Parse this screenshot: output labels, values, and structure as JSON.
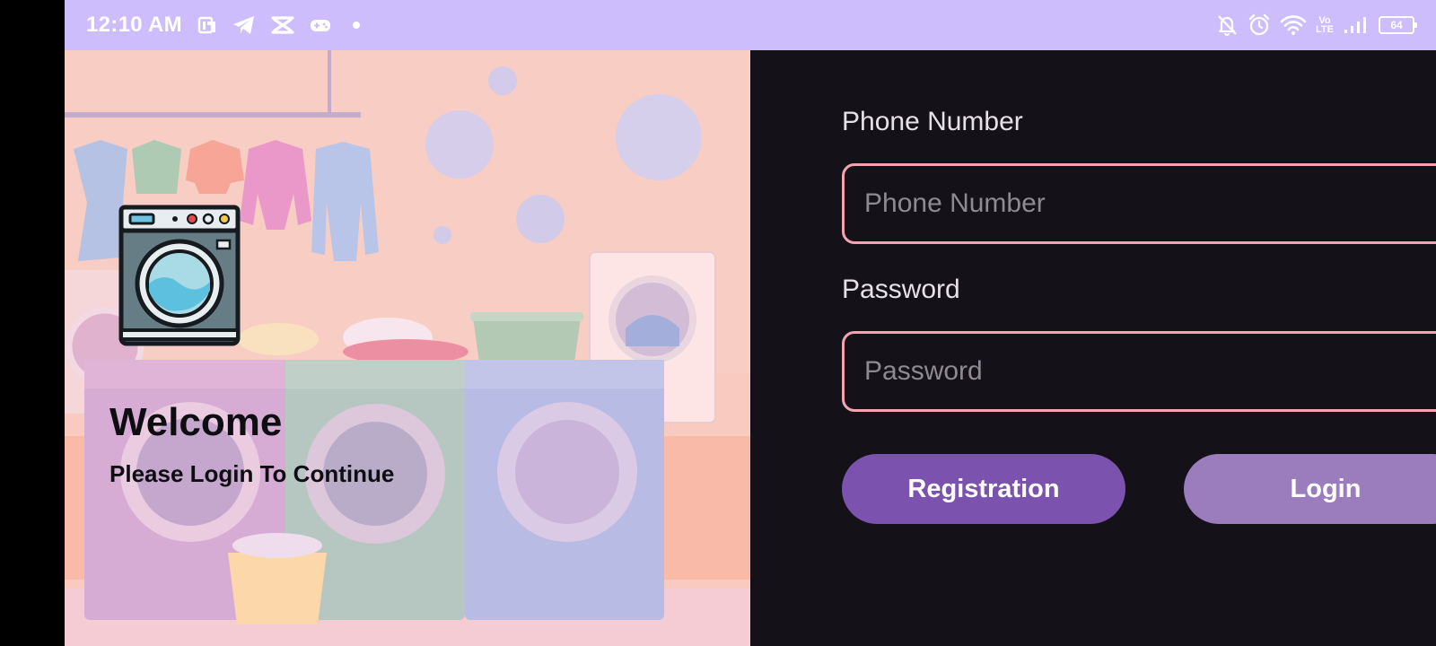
{
  "status_bar": {
    "time": "12:10 AM",
    "battery_level": "64",
    "network_type_label": "Vo\nLTE",
    "left_icons": [
      "pocket-app-icon",
      "telegram-icon",
      "capcut-icon",
      "gamepad-icon",
      "notification-dot-icon"
    ],
    "right_icons": [
      "silent-bell-icon",
      "alarm-icon",
      "wifi-icon",
      "volte-icon",
      "signal-icon",
      "battery-icon"
    ],
    "background_color": "#cdbdfd"
  },
  "welcome": {
    "title": "Welcome",
    "subtitle": "Please Login To Continue"
  },
  "form": {
    "phone": {
      "label": "Phone Number",
      "placeholder": "Phone Number",
      "value": ""
    },
    "password": {
      "label": "Password",
      "placeholder": "Password",
      "value": ""
    },
    "registration_label": "Registration",
    "login_label": "Login"
  },
  "colors": {
    "background": "#141218",
    "input_border": "#f5a3b1",
    "registration_button": "#7b52ae",
    "login_button": "#9b7dbe",
    "illustration_tint": "#f7c6b8"
  }
}
